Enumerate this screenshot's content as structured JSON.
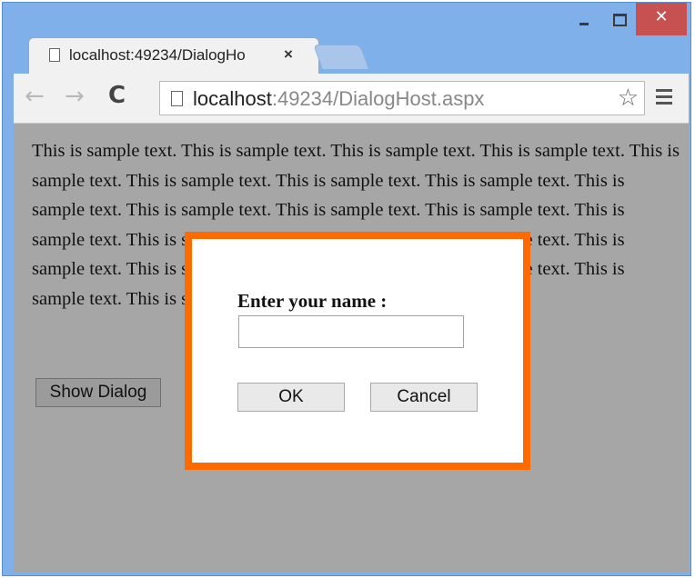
{
  "window": {
    "controls": {
      "minimize_icon": "minimize-icon",
      "maximize_icon": "maximize-icon",
      "close_label": "✕"
    }
  },
  "tab": {
    "title": "localhost:49234/DialogHo",
    "close_label": "×",
    "icon": "page-icon"
  },
  "toolbar": {
    "back_icon": "←",
    "forward_icon": "→",
    "reload_icon": "C",
    "url_host": "localhost",
    "url_rest": ":49234/DialogHost.aspx",
    "star_icon": "☆",
    "menu_icon": "hamburger-menu-icon"
  },
  "page": {
    "sample_text": "This is sample text. This is sample text. This is sample text. This is sample text. This is sample text. This is sample text. This is sample text. This is sample text. This is sample text. This is sample text. This is sample text. This is sample text. This is sample text. This is sample text. This is sample text. This is sample text. This is sample text. This is sample text. This is sample text. This is sample text. This is sample text. This is sample text.",
    "show_dialog_label": "Show Dialog"
  },
  "dialog": {
    "label": "Enter your name :",
    "input_value": "",
    "ok_label": "OK",
    "cancel_label": "Cancel",
    "border_color": "#ff6a00"
  },
  "colors": {
    "titlebar": "#7fb0ea",
    "close_button": "#c75050",
    "overlay": "#a6a6a6"
  }
}
